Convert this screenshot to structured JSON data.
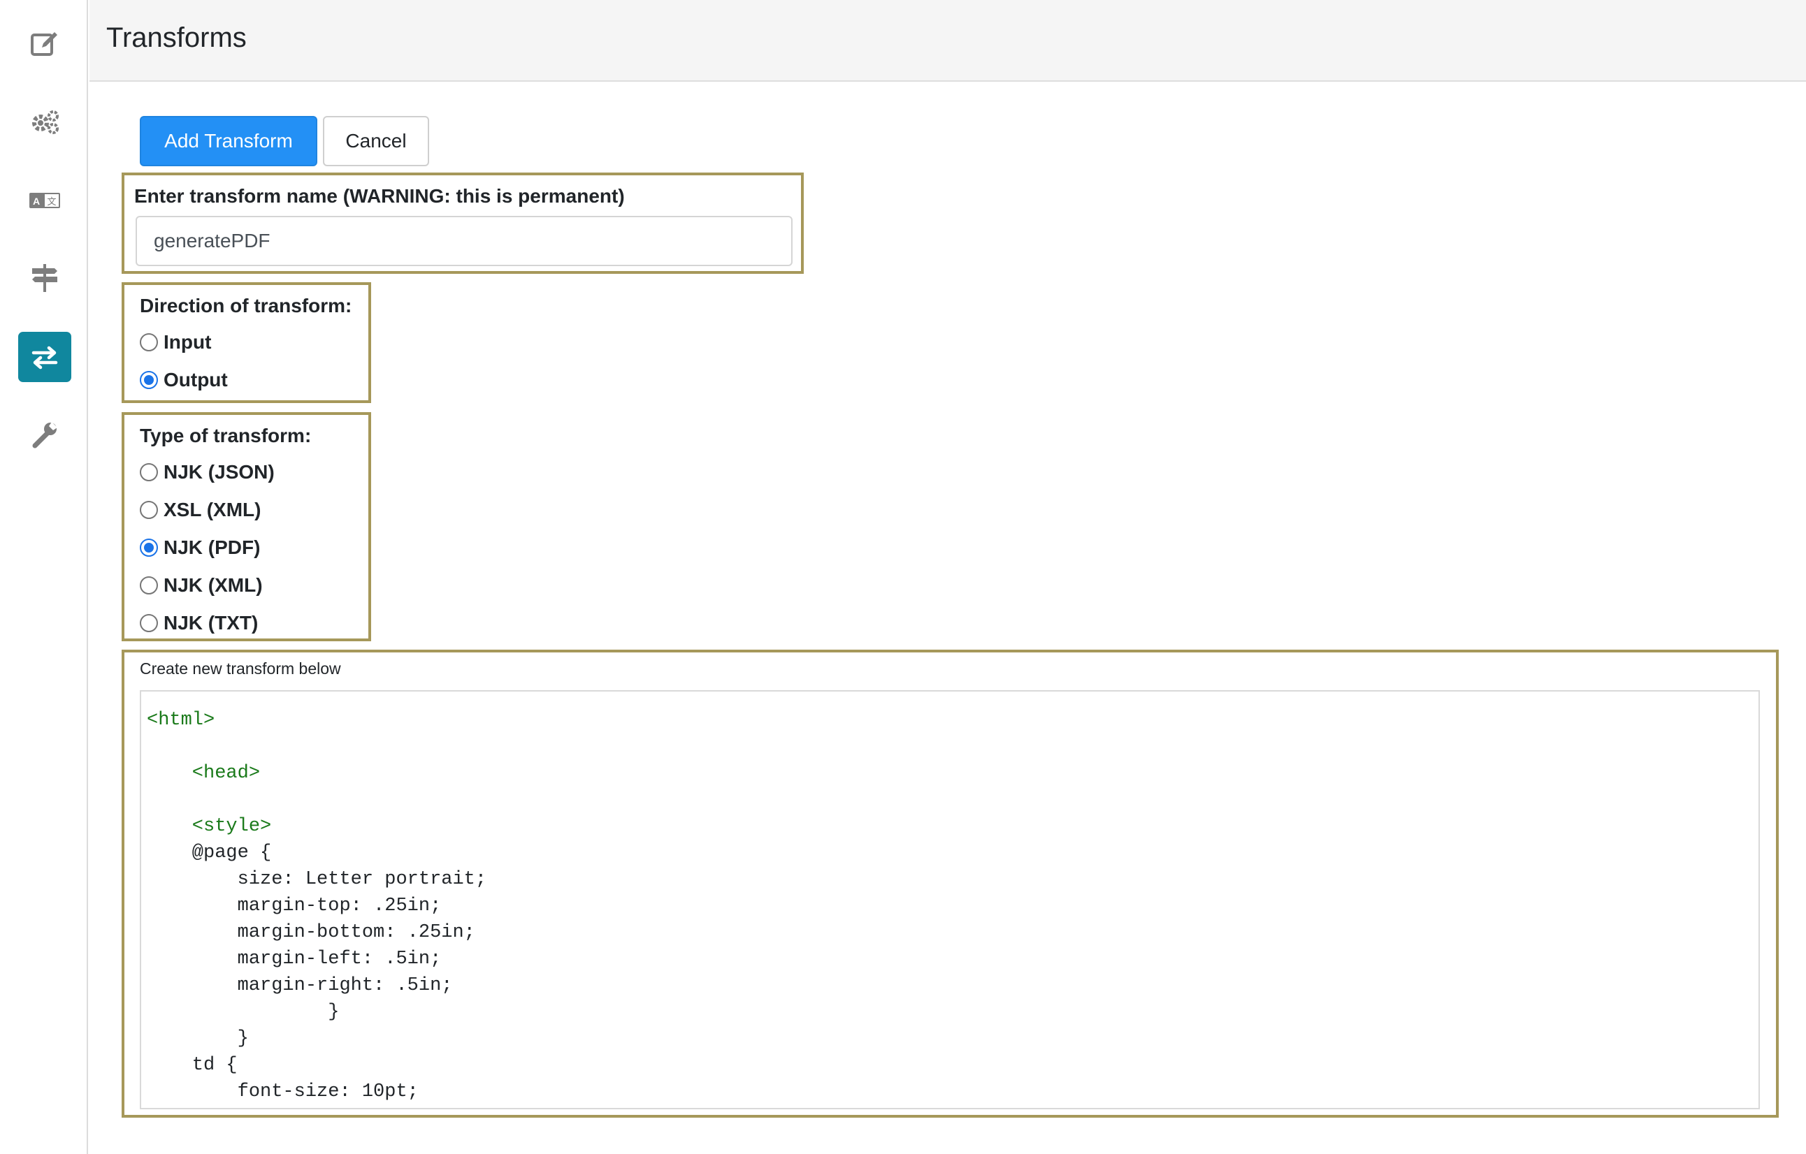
{
  "sidebar": {
    "items": [
      {
        "name": "edit",
        "icon": "edit-icon",
        "active": false
      },
      {
        "name": "settings",
        "icon": "gears-icon",
        "active": false
      },
      {
        "name": "translate",
        "icon": "translate-icon",
        "active": false
      },
      {
        "name": "routing",
        "icon": "signpost-icon",
        "active": false
      },
      {
        "name": "transforms",
        "icon": "exchange-arrows-icon",
        "active": true
      },
      {
        "name": "tools",
        "icon": "wrench-icon",
        "active": false
      }
    ],
    "accent": "#10879e"
  },
  "header": {
    "title": "Transforms"
  },
  "toolbar": {
    "add_label": "Add Transform",
    "cancel_label": "Cancel"
  },
  "form": {
    "name_label": "Enter transform name (WARNING: this is permanent)",
    "name_value": "generatePDF",
    "direction": {
      "label": "Direction of transform:",
      "options": [
        {
          "label": "Input",
          "checked": false
        },
        {
          "label": "Output",
          "checked": true
        }
      ]
    },
    "type": {
      "label": "Type of transform:",
      "options": [
        {
          "label": "NJK (JSON)",
          "checked": false
        },
        {
          "label": "XSL (XML)",
          "checked": false
        },
        {
          "label": "NJK (PDF)",
          "checked": true
        },
        {
          "label": "NJK (XML)",
          "checked": false
        },
        {
          "label": "NJK (TXT)",
          "checked": false
        }
      ]
    },
    "code_caption": "Create new transform below",
    "code_lines": [
      {
        "text": "<html>",
        "kind": "tag"
      },
      {
        "text": "",
        "kind": "plain"
      },
      {
        "text": "    <head>",
        "kind": "tag"
      },
      {
        "text": "",
        "kind": "plain"
      },
      {
        "text": "    <style>",
        "kind": "tag"
      },
      {
        "text": "    @page {",
        "kind": "plain"
      },
      {
        "text": "        size: Letter portrait;",
        "kind": "plain"
      },
      {
        "text": "        margin-top: .25in;",
        "kind": "plain"
      },
      {
        "text": "        margin-bottom: .25in;",
        "kind": "plain"
      },
      {
        "text": "        margin-left: .5in;",
        "kind": "plain"
      },
      {
        "text": "        margin-right: .5in;",
        "kind": "plain"
      },
      {
        "text": "                }",
        "kind": "plain"
      },
      {
        "text": "        }",
        "kind": "plain"
      },
      {
        "text": "    td {",
        "kind": "plain"
      },
      {
        "text": "        font-size: 10pt;",
        "kind": "plain"
      }
    ]
  },
  "colors": {
    "primary": "#2390f5",
    "box_border": "#a6985a",
    "tag_green": "#1a7a1a"
  }
}
